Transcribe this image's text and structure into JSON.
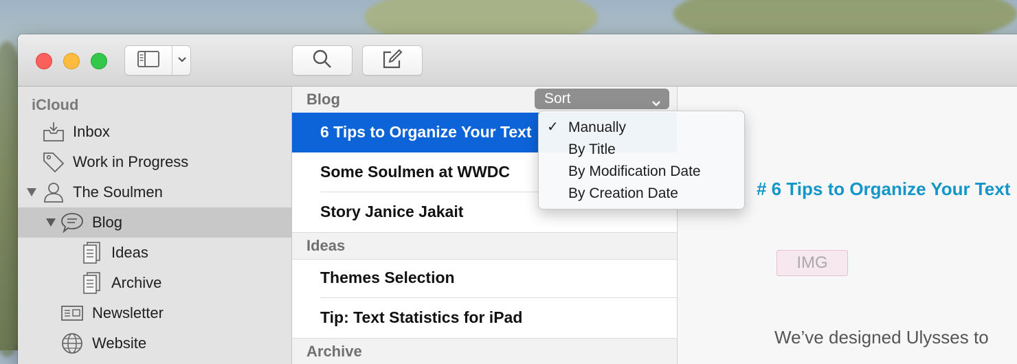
{
  "toolbar": {
    "sidebar_toggle_icon": "sidebar-icon",
    "dropdown_icon": "chevron-down-icon",
    "search_icon": "search-icon",
    "compose_icon": "compose-icon"
  },
  "sidebar": {
    "section_title": "iCloud",
    "items": [
      {
        "label": "Inbox",
        "icon": "inbox-icon"
      },
      {
        "label": "Work in Progress",
        "icon": "tag-icon"
      },
      {
        "label": "The Soulmen",
        "icon": "person-icon"
      },
      {
        "label": "Blog",
        "icon": "speech-bubble-icon"
      },
      {
        "label": "Ideas",
        "icon": "sheet-icon"
      },
      {
        "label": "Archive",
        "icon": "sheet-icon"
      },
      {
        "label": "Newsletter",
        "icon": "newsletter-icon"
      },
      {
        "label": "Website",
        "icon": "globe-icon"
      }
    ]
  },
  "list": {
    "sort_label": "Sort",
    "groups": [
      {
        "title": "Blog",
        "items": [
          "6 Tips to Organize Your Text",
          "Some Soulmen at WWDC",
          "Story Janice Jakait"
        ]
      },
      {
        "title": "Ideas",
        "items": [
          "Themes Selection",
          "Tip: Text Statistics for iPad"
        ]
      },
      {
        "title": "Archive",
        "items": []
      }
    ]
  },
  "sort_menu": {
    "checked": "Manually",
    "items": [
      "Manually",
      "By Title",
      "By Modification Date",
      "By Creation Date"
    ]
  },
  "editor": {
    "heading": "# 6 Tips to Organize Your Text",
    "img_tag": "IMG",
    "body": "We’ve designed Ulysses to"
  },
  "colors": {
    "selection": "#0d63d8",
    "heading": "#1496c8",
    "sidebar_bg": "#e3e3e3"
  }
}
